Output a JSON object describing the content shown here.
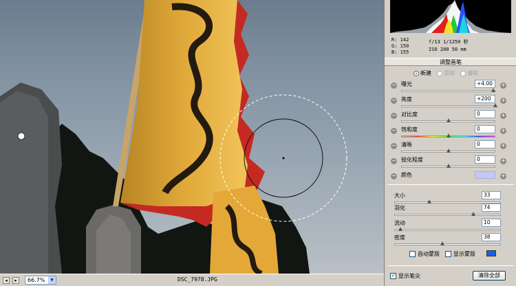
{
  "statusbar": {
    "btn_prev": "◂",
    "btn_next": "▸",
    "zoom": "66.7%",
    "filename": "DSC_7978.JPG"
  },
  "info": {
    "r": "R:  142",
    "g": "G:  150",
    "b": "B:  155",
    "aperture_shutter": "f/13  1/1250 秒",
    "iso_focal": "ISO 200  50 mm"
  },
  "panel_title": "调整画笔",
  "modes": [
    {
      "label": "新建",
      "selected": true
    },
    {
      "label": "添加",
      "selected": false
    },
    {
      "label": "清除",
      "selected": false
    }
  ],
  "adjustments": [
    {
      "label": "曝光",
      "value": "+4.00",
      "level": 0.98
    },
    {
      "label": "亮度",
      "value": "+200",
      "level": 1.0
    },
    {
      "label": "对比度",
      "value": "0",
      "level": 0.5
    },
    {
      "label": "饱和度",
      "value": "0",
      "level": 0.5
    },
    {
      "label": "清晰",
      "value": "0",
      "level": 0.5
    },
    {
      "label": "锐化程度",
      "value": "0",
      "level": 0.5
    }
  ],
  "color": {
    "label": "颜色",
    "swatch": "#c4c8f2"
  },
  "brush": [
    {
      "label": "大小",
      "value": "33",
      "level": 0.33
    },
    {
      "label": "羽化",
      "value": "74",
      "level": 0.74
    },
    {
      "label": "流动",
      "value": "10",
      "level": 0.06
    },
    {
      "label": "密度",
      "value": "38",
      "level": 0.45
    }
  ],
  "auto_mask": {
    "label": "自动蒙版",
    "checked": false
  },
  "show_mask": {
    "label": "显示蒙版",
    "checked": false,
    "color": "#1a5ff0"
  },
  "show_pins": {
    "label": "显示笔尖",
    "checked": true
  },
  "clear_all_label": "清除全部",
  "sign": {
    "minus": "−",
    "plus": "+"
  }
}
